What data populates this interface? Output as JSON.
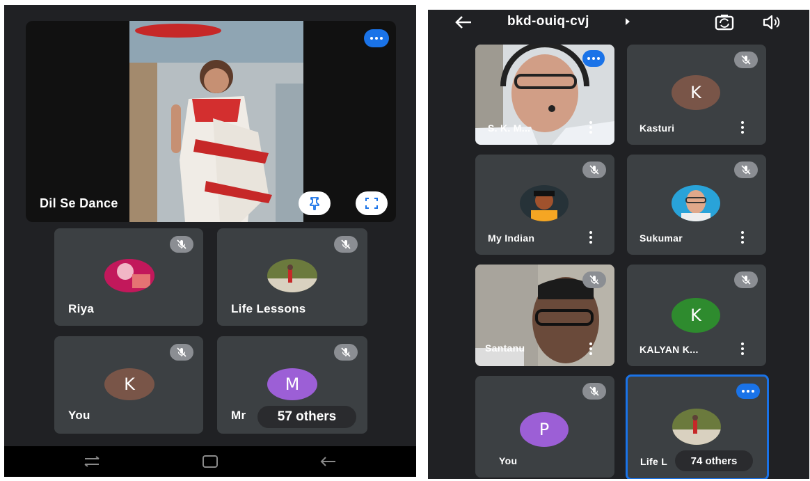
{
  "left": {
    "featured": {
      "name": "Dil Se Dance"
    },
    "tiles": [
      {
        "name": "Riya"
      },
      {
        "name": "Life Lessons"
      },
      {
        "name": "You",
        "initial": "K"
      },
      {
        "name": "Mr",
        "initial": "M",
        "others": "57 others"
      }
    ],
    "navbar": [
      "recent-apps",
      "home",
      "back"
    ]
  },
  "right": {
    "meeting_code": "bkd-ouiq-cvj",
    "tiles": [
      {
        "name": "S. K. M..."
      },
      {
        "name": "Kasturi",
        "initial": "K"
      },
      {
        "name": "My Indian"
      },
      {
        "name": "Sukumar"
      },
      {
        "name": "Santanu"
      },
      {
        "name": "KALYAN K...",
        "initial": "K"
      },
      {
        "name": "You",
        "initial": "P"
      },
      {
        "name": "Life L",
        "others": "74 others"
      }
    ]
  },
  "colors": {
    "tile_bg": "#3c4043",
    "screen_bg": "#202124",
    "speaking_blue": "#1a73e8",
    "avatar_brown": "#795548",
    "avatar_purple": "#9c5fd6",
    "avatar_green": "#2e8b2e"
  }
}
